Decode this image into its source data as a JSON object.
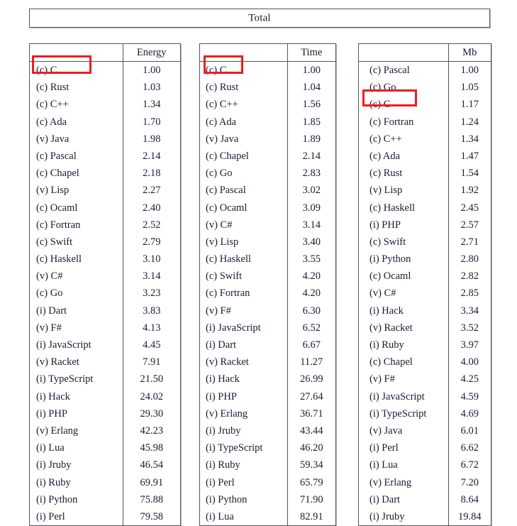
{
  "banner": {
    "title": "Total"
  },
  "tables": [
    {
      "id": "energy",
      "name_header": "",
      "value_header": "Energy",
      "highlighted_row": "(c) C",
      "rows": [
        {
          "lang": "(c) C",
          "value": "1.00"
        },
        {
          "lang": "(c) Rust",
          "value": "1.03"
        },
        {
          "lang": "(c) C++",
          "value": "1.34"
        },
        {
          "lang": "(c) Ada",
          "value": "1.70"
        },
        {
          "lang": "(v) Java",
          "value": "1.98"
        },
        {
          "lang": "(c) Pascal",
          "value": "2.14"
        },
        {
          "lang": "(c) Chapel",
          "value": "2.18"
        },
        {
          "lang": "(v) Lisp",
          "value": "2.27"
        },
        {
          "lang": "(c) Ocaml",
          "value": "2.40"
        },
        {
          "lang": "(c) Fortran",
          "value": "2.52"
        },
        {
          "lang": "(c) Swift",
          "value": "2.79"
        },
        {
          "lang": "(c) Haskell",
          "value": "3.10"
        },
        {
          "lang": "(v) C#",
          "value": "3.14"
        },
        {
          "lang": "(c) Go",
          "value": "3.23"
        },
        {
          "lang": "(i) Dart",
          "value": "3.83"
        },
        {
          "lang": "(v) F#",
          "value": "4.13"
        },
        {
          "lang": "(i) JavaScript",
          "value": "4.45"
        },
        {
          "lang": "(v) Racket",
          "value": "7.91"
        },
        {
          "lang": "(i) TypeScript",
          "value": "21.50"
        },
        {
          "lang": "(i) Hack",
          "value": "24.02"
        },
        {
          "lang": "(i) PHP",
          "value": "29.30"
        },
        {
          "lang": "(v) Erlang",
          "value": "42.23"
        },
        {
          "lang": "(i) Lua",
          "value": "45.98"
        },
        {
          "lang": "(i) Jruby",
          "value": "46.54"
        },
        {
          "lang": "(i) Ruby",
          "value": "69.91"
        },
        {
          "lang": "(i) Python",
          "value": "75.88"
        },
        {
          "lang": "(i) Perl",
          "value": "79.58"
        }
      ]
    },
    {
      "id": "time",
      "name_header": "",
      "value_header": "Time",
      "highlighted_row": "(c) C",
      "rows": [
        {
          "lang": "(c) C",
          "value": "1.00"
        },
        {
          "lang": "(c) Rust",
          "value": "1.04"
        },
        {
          "lang": "(c) C++",
          "value": "1.56"
        },
        {
          "lang": "(c) Ada",
          "value": "1.85"
        },
        {
          "lang": "(v) Java",
          "value": "1.89"
        },
        {
          "lang": "(c) Chapel",
          "value": "2.14"
        },
        {
          "lang": "(c) Go",
          "value": "2.83"
        },
        {
          "lang": "(c) Pascal",
          "value": "3.02"
        },
        {
          "lang": "(c) Ocaml",
          "value": "3.09"
        },
        {
          "lang": "(v) C#",
          "value": "3.14"
        },
        {
          "lang": "(v) Lisp",
          "value": "3.40"
        },
        {
          "lang": "(c) Haskell",
          "value": "3.55"
        },
        {
          "lang": "(c) Swift",
          "value": "4.20"
        },
        {
          "lang": "(c) Fortran",
          "value": "4.20"
        },
        {
          "lang": "(v) F#",
          "value": "6.30"
        },
        {
          "lang": "(i) JavaScript",
          "value": "6.52"
        },
        {
          "lang": "(i) Dart",
          "value": "6.67"
        },
        {
          "lang": "(v) Racket",
          "value": "11.27"
        },
        {
          "lang": "(i) Hack",
          "value": "26.99"
        },
        {
          "lang": "(i) PHP",
          "value": "27.64"
        },
        {
          "lang": "(v) Erlang",
          "value": "36.71"
        },
        {
          "lang": "(i) Jruby",
          "value": "43.44"
        },
        {
          "lang": "(i) TypeScript",
          "value": "46.20"
        },
        {
          "lang": "(i) Ruby",
          "value": "59.34"
        },
        {
          "lang": "(i) Perl",
          "value": "65.79"
        },
        {
          "lang": "(i) Python",
          "value": "71.90"
        },
        {
          "lang": "(i) Lua",
          "value": "82.91"
        }
      ]
    },
    {
      "id": "mb",
      "name_header": "",
      "value_header": "Mb",
      "highlighted_row": "(c) C",
      "rows": [
        {
          "lang": "(c) Pascal",
          "value": "1.00"
        },
        {
          "lang": "(c) Go",
          "value": "1.05"
        },
        {
          "lang": "(c) C",
          "value": "1.17"
        },
        {
          "lang": "(c) Fortran",
          "value": "1.24"
        },
        {
          "lang": "(c) C++",
          "value": "1.34"
        },
        {
          "lang": "(c) Ada",
          "value": "1.47"
        },
        {
          "lang": "(c) Rust",
          "value": "1.54"
        },
        {
          "lang": "(v) Lisp",
          "value": "1.92"
        },
        {
          "lang": "(c) Haskell",
          "value": "2.45"
        },
        {
          "lang": "(i) PHP",
          "value": "2.57"
        },
        {
          "lang": "(c) Swift",
          "value": "2.71"
        },
        {
          "lang": "(i) Python",
          "value": "2.80"
        },
        {
          "lang": "(c) Ocaml",
          "value": "2.82"
        },
        {
          "lang": "(v) C#",
          "value": "2.85"
        },
        {
          "lang": "(i) Hack",
          "value": "3.34"
        },
        {
          "lang": "(v) Racket",
          "value": "3.52"
        },
        {
          "lang": "(i) Ruby",
          "value": "3.97"
        },
        {
          "lang": "(c) Chapel",
          "value": "4.00"
        },
        {
          "lang": "(v) F#",
          "value": "4.25"
        },
        {
          "lang": "(i) JavaScript",
          "value": "4.59"
        },
        {
          "lang": "(i) TypeScript",
          "value": "4.69"
        },
        {
          "lang": "(v) Java",
          "value": "6.01"
        },
        {
          "lang": "(i) Perl",
          "value": "6.62"
        },
        {
          "lang": "(i) Lua",
          "value": "6.72"
        },
        {
          "lang": "(v) Erlang",
          "value": "7.20"
        },
        {
          "lang": "(i) Dart",
          "value": "8.64"
        },
        {
          "lang": "(i) Jruby",
          "value": "19.84"
        }
      ]
    }
  ],
  "annotations": {
    "highlight_color": "#ef1d1d",
    "boxes": [
      {
        "target_table": "energy",
        "target_row": "(c) C"
      },
      {
        "target_table": "time",
        "target_row": "(c) C"
      },
      {
        "target_table": "mb",
        "target_row": "(c) C"
      }
    ]
  },
  "chart_data": {
    "type": "table",
    "title": "Total",
    "tables": [
      {
        "title": "Energy",
        "categories": [
          "(c) C",
          "(c) Rust",
          "(c) C++",
          "(c) Ada",
          "(v) Java",
          "(c) Pascal",
          "(c) Chapel",
          "(v) Lisp",
          "(c) Ocaml",
          "(c) Fortran",
          "(c) Swift",
          "(c) Haskell",
          "(v) C#",
          "(c) Go",
          "(i) Dart",
          "(v) F#",
          "(i) JavaScript",
          "(v) Racket",
          "(i) TypeScript",
          "(i) Hack",
          "(i) PHP",
          "(v) Erlang",
          "(i) Lua",
          "(i) Jruby",
          "(i) Ruby",
          "(i) Python",
          "(i) Perl"
        ],
        "values": [
          1.0,
          1.03,
          1.34,
          1.7,
          1.98,
          2.14,
          2.18,
          2.27,
          2.4,
          2.52,
          2.79,
          3.1,
          3.14,
          3.23,
          3.83,
          4.13,
          4.45,
          7.91,
          21.5,
          24.02,
          29.3,
          42.23,
          45.98,
          46.54,
          69.91,
          75.88,
          79.58
        ]
      },
      {
        "title": "Time",
        "categories": [
          "(c) C",
          "(c) Rust",
          "(c) C++",
          "(c) Ada",
          "(v) Java",
          "(c) Chapel",
          "(c) Go",
          "(c) Pascal",
          "(c) Ocaml",
          "(v) C#",
          "(v) Lisp",
          "(c) Haskell",
          "(c) Swift",
          "(c) Fortran",
          "(v) F#",
          "(i) JavaScript",
          "(i) Dart",
          "(v) Racket",
          "(i) Hack",
          "(i) PHP",
          "(v) Erlang",
          "(i) Jruby",
          "(i) TypeScript",
          "(i) Ruby",
          "(i) Perl",
          "(i) Python",
          "(i) Lua"
        ],
        "values": [
          1.0,
          1.04,
          1.56,
          1.85,
          1.89,
          2.14,
          2.83,
          3.02,
          3.09,
          3.14,
          3.4,
          3.55,
          4.2,
          4.2,
          6.3,
          6.52,
          6.67,
          11.27,
          26.99,
          27.64,
          36.71,
          43.44,
          46.2,
          59.34,
          65.79,
          71.9,
          82.91
        ]
      },
      {
        "title": "Mb",
        "categories": [
          "(c) Pascal",
          "(c) Go",
          "(c) C",
          "(c) Fortran",
          "(c) C++",
          "(c) Ada",
          "(c) Rust",
          "(v) Lisp",
          "(c) Haskell",
          "(i) PHP",
          "(c) Swift",
          "(i) Python",
          "(c) Ocaml",
          "(v) C#",
          "(i) Hack",
          "(v) Racket",
          "(i) Ruby",
          "(c) Chapel",
          "(v) F#",
          "(i) JavaScript",
          "(i) TypeScript",
          "(v) Java",
          "(i) Perl",
          "(i) Lua",
          "(v) Erlang",
          "(i) Dart",
          "(i) Jruby"
        ],
        "values": [
          1.0,
          1.05,
          1.17,
          1.24,
          1.34,
          1.47,
          1.54,
          1.92,
          2.45,
          2.57,
          2.71,
          2.8,
          2.82,
          2.85,
          3.34,
          3.52,
          3.97,
          4.0,
          4.25,
          4.59,
          4.69,
          6.01,
          6.62,
          6.72,
          7.2,
          8.64,
          19.84
        ]
      }
    ]
  }
}
